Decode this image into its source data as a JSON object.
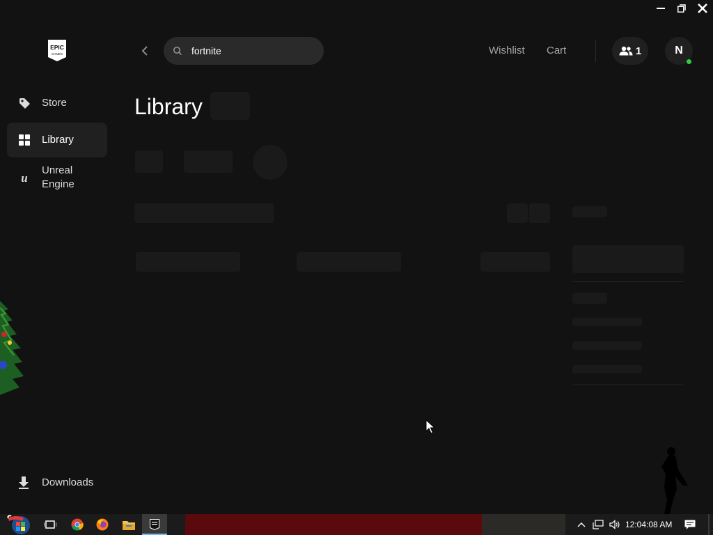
{
  "window": {
    "minimize_icon": "minimize-icon",
    "restore_icon": "restore-icon",
    "close_icon": "close-icon"
  },
  "brand": {
    "logo_text_top": "EPIC",
    "logo_text_bottom": "GAMES"
  },
  "sidebar": {
    "items": [
      {
        "label": "Store",
        "icon": "tag-icon"
      },
      {
        "label": "Library",
        "icon": "grid-icon",
        "active": true
      },
      {
        "label": "Unreal Engine",
        "label_line1": "Unreal",
        "label_line2": "Engine",
        "icon": "unreal-icon"
      }
    ],
    "downloads_label": "Downloads"
  },
  "topbar": {
    "search_value": "fortnite",
    "wishlist_label": "Wishlist",
    "cart_label": "Cart",
    "friends_count": "1",
    "avatar_initial": "N"
  },
  "main": {
    "title": "Library"
  },
  "taskbar": {
    "clock": "12:04:08 AM"
  },
  "colors": {
    "background": "#121212",
    "sidebar_active": "#202020",
    "search_bg": "#2a2a2a",
    "skeleton": "#1a1a1a",
    "online": "#2ecc40",
    "taskbar": "#1b1b1b"
  }
}
